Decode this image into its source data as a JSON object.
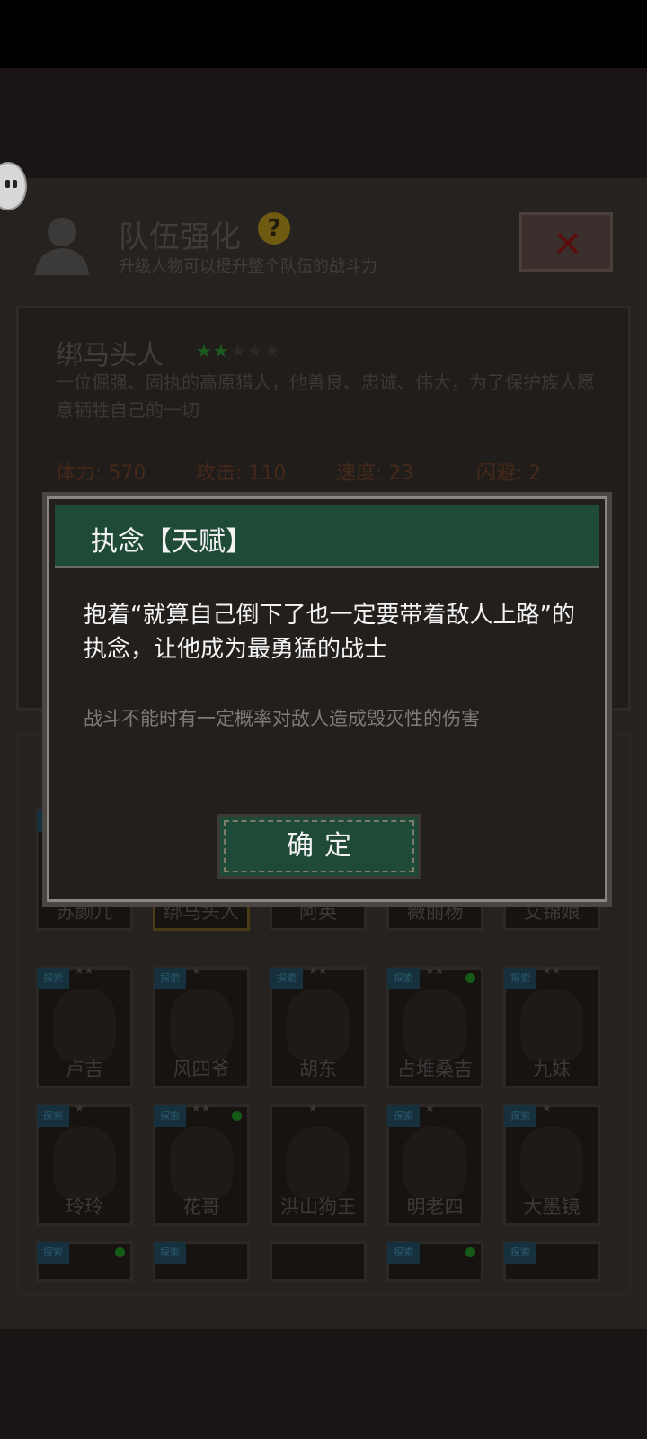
{
  "header": {
    "title": "队伍强化",
    "help_icon": "?",
    "subtitle": "升级人物可以提升整个队伍的战斗力",
    "close_icon": "✕"
  },
  "character": {
    "name": "绑马头人",
    "stars": "★★★★★",
    "description": "一位倔强、固执的高原猎人，他善良、忠诚、伟大，为了保护族人愿意牺牲自己的一切",
    "stats": {
      "hp": "体力: 570",
      "attack": "攻击: 110",
      "speed": "速度: 23",
      "dodge": "闪避: 2"
    }
  },
  "grid": {
    "row0": [
      "苏颜儿",
      "绑马头人",
      "阿英",
      "薇丽杨",
      "艾锦娘"
    ],
    "row1": [
      "卢吉",
      "风四爷",
      "胡东",
      "占堆桑吉",
      "九妹"
    ],
    "row2": [
      "玲玲",
      "花哥",
      "洪山狗王",
      "明老四",
      "大墨镜"
    ],
    "tag": "探索"
  },
  "modal": {
    "title": "执念【天赋】",
    "text": "抱着“就算自己倒下了也一定要带着敌人上路”的执念，让他成为最勇猛的战士",
    "sub": "战斗不能时有一定概率对敌人造成毁灭性的伤害",
    "confirm": "确定"
  },
  "colors": {
    "modal_header": "#1f4a37",
    "green_star": "#1d5a1f",
    "stat_text": "#44291a"
  }
}
